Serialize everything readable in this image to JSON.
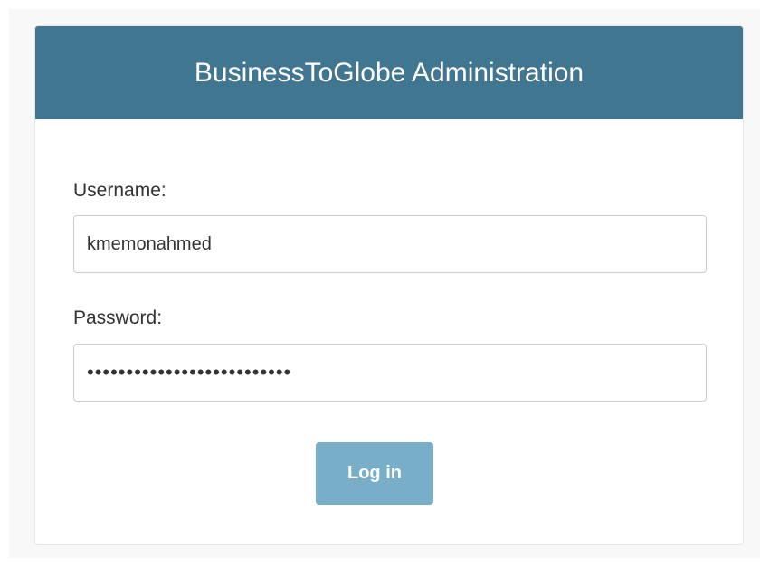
{
  "header": {
    "title": "BusinessToGlobe Administration"
  },
  "form": {
    "username_label": "Username:",
    "username_value": "kmemonahmed",
    "password_label": "Password:",
    "password_value": "••••••••••••••••••••••••••",
    "submit_label": "Log in"
  },
  "colors": {
    "header_bg": "#417690",
    "button_bg": "#79aec8",
    "page_bg": "#f8f8f8"
  }
}
